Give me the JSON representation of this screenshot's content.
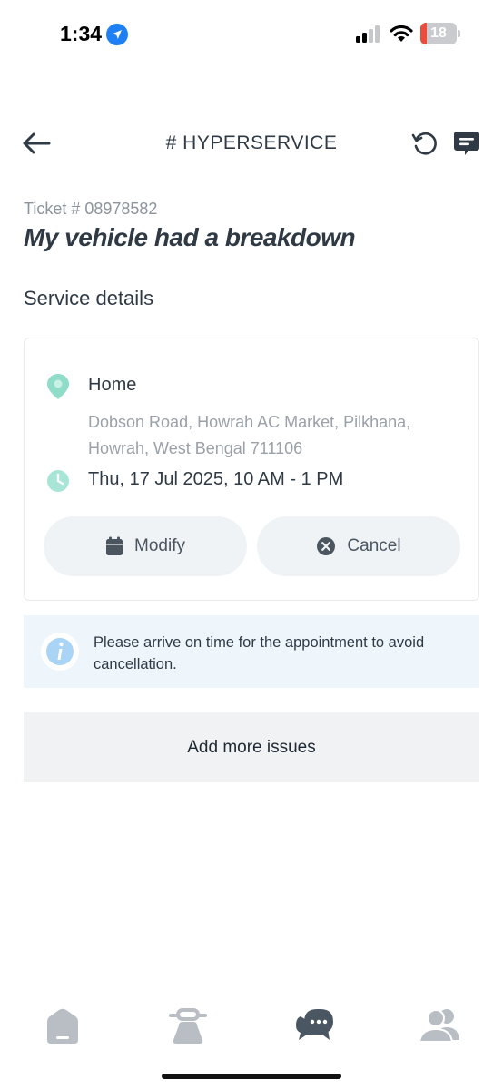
{
  "status_bar": {
    "time": "1:34",
    "battery": "18",
    "battery_level": 0.18,
    "colors": {
      "battery_low": "#eb4d3d",
      "location": "#1f7ff5"
    }
  },
  "header": {
    "title": "# HYPERSERVICE",
    "icons": [
      "back-arrow-icon",
      "history-icon",
      "chat-icon"
    ]
  },
  "ticket": {
    "number": "Ticket # 08978582",
    "title": "My vehicle had a breakdown"
  },
  "service": {
    "section_title": "Service details",
    "place": "Home",
    "address": "Dobson Road, Howrah AC Market, Pilkhana, Howrah, West Bengal 711106",
    "slot": "Thu, 17 Jul 2025, 10 AM - 1 PM",
    "modify_label": "Modify",
    "cancel_label": "Cancel",
    "accent_color": "#8fdcc9"
  },
  "notice": {
    "text": "Please arrive on time for the appointment to avoid cancellation."
  },
  "add_issues_label": "Add more issues",
  "bottom_nav": {
    "items": [
      "home-icon",
      "service-icon",
      "chat-icon",
      "account-icon"
    ]
  }
}
